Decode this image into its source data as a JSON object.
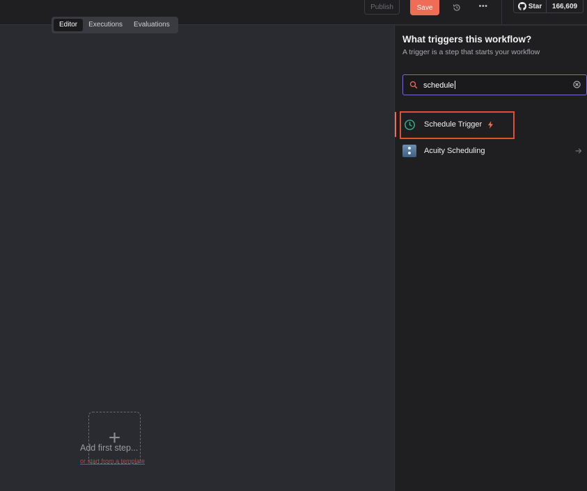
{
  "header": {
    "publish_label": "Publish",
    "save_label": "Save",
    "github": {
      "star_label": "Star",
      "star_count": "166,609"
    }
  },
  "tabs": [
    {
      "label": "Editor",
      "active": true
    },
    {
      "label": "Executions",
      "active": false
    },
    {
      "label": "Evaluations",
      "active": false
    }
  ],
  "canvas": {
    "add_first_step_label": "Add first step...",
    "template_link_label": "or start from a template"
  },
  "trigger_panel": {
    "title": "What triggers this workflow?",
    "subtitle": "A trigger is a step that starts your workflow",
    "search": {
      "value": "schedule"
    },
    "results": [
      {
        "label": "Schedule Trigger",
        "icon": "clock-icon",
        "badge_icon": "bolt-icon",
        "highlighted": true
      },
      {
        "label": "Acuity Scheduling",
        "icon": "acuity-scheduling-icon",
        "trailing_icon": "arrow-right-icon"
      }
    ]
  },
  "colors": {
    "accent": "#ef6c57",
    "search_border": "#7b6ad6",
    "highlight_outline": "#e2502f",
    "clock_icon": "#2fb28a"
  }
}
